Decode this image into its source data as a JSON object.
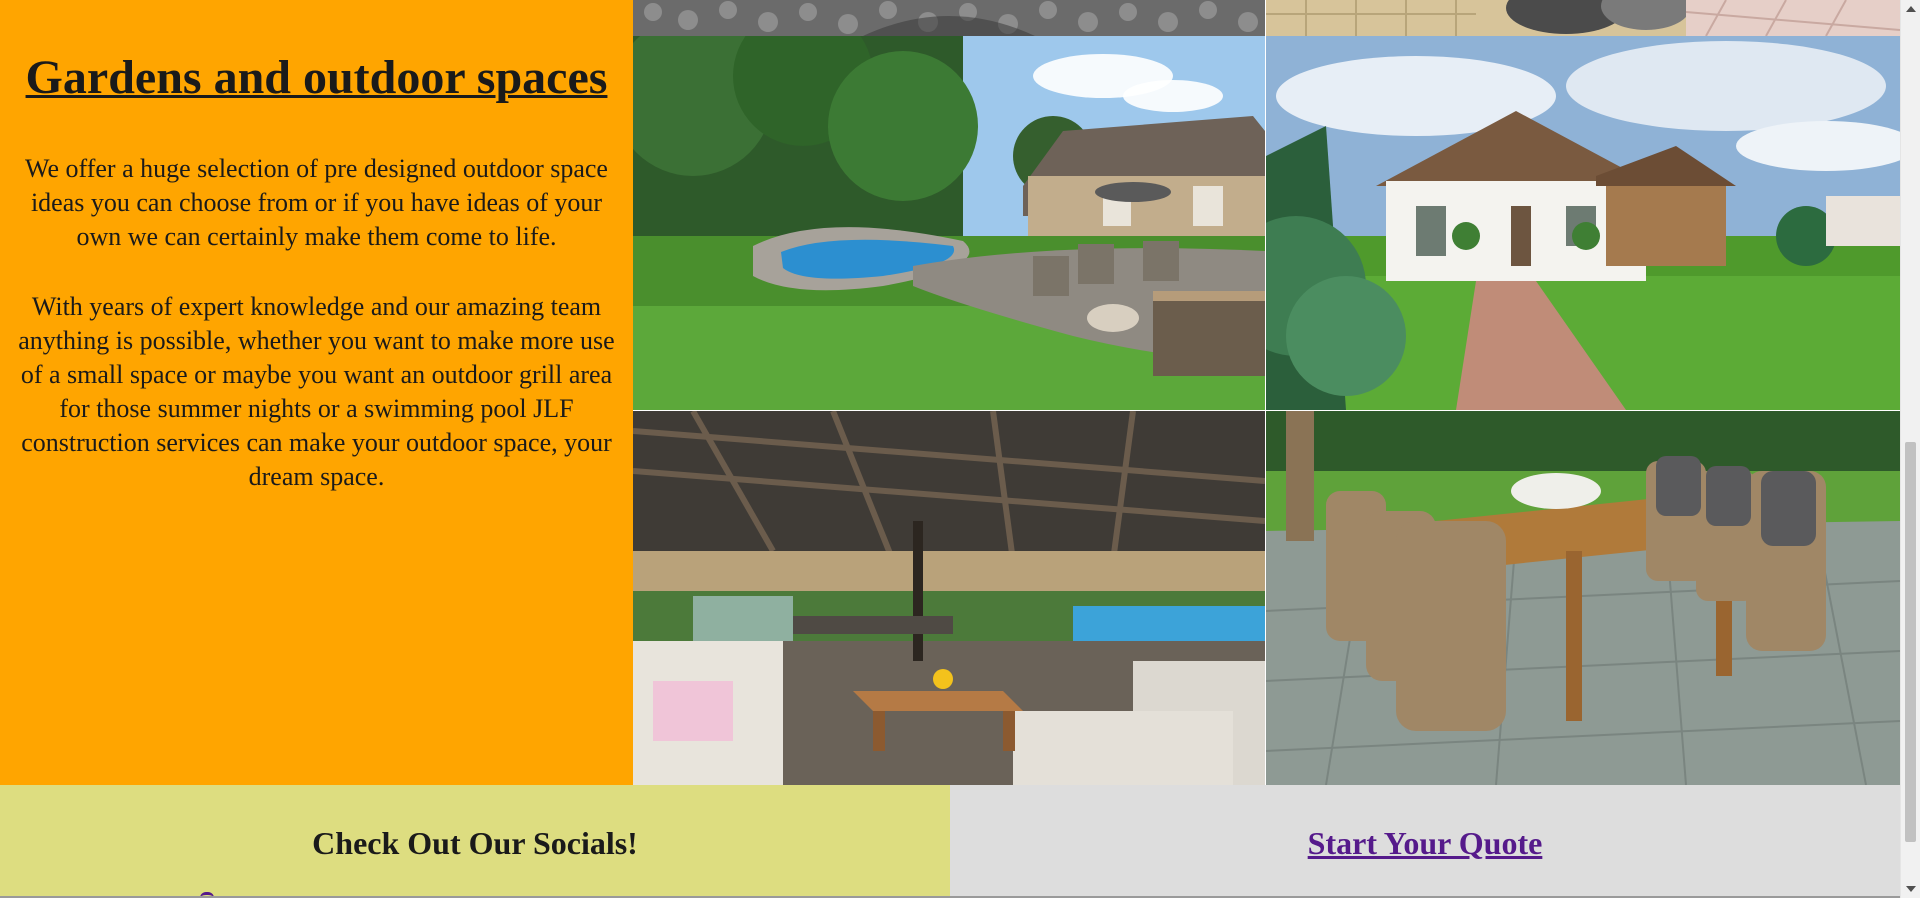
{
  "gallery": {
    "heading": "Gardens and outdoor spaces",
    "paragraph_1": "We offer a huge selection of pre designed outdoor space ideas you can choose from or if you have ideas of your own we can certainly make them come to life.",
    "paragraph_2": "With years of expert knowledge and our amazing team anything is possible, whether you want to make more use of a small space or maybe you want an outdoor grill area for those summer nights or a swimming pool JLF construction services can make your outdoor space, your dream space.",
    "panel_color": "#FFA500"
  },
  "footer": {
    "socials_heading": "Check Out Our Socials!",
    "quote_link": "Start Your Quote",
    "left_color": "#DDDD80",
    "right_color": "#DDDDDD",
    "link_color": "#551A8B"
  }
}
